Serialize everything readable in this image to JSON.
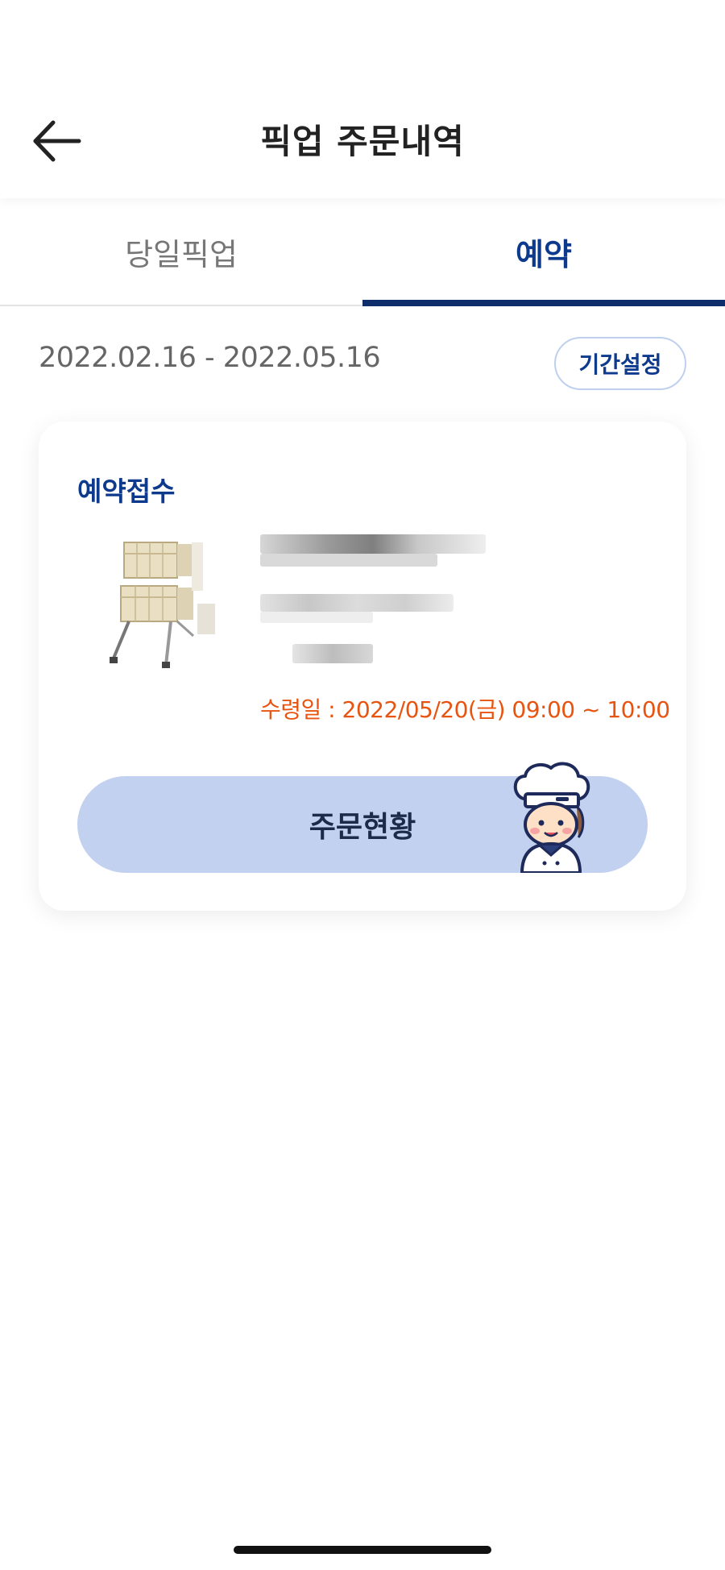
{
  "header": {
    "title": "픽업 주문내역",
    "back_icon": "back-arrow-icon"
  },
  "tabs": [
    {
      "label": "당일픽업",
      "active": false
    },
    {
      "label": "예약",
      "active": true
    }
  ],
  "period": {
    "range": "2022.02.16 - 2022.05.16",
    "button_label": "기간설정"
  },
  "order": {
    "status": "예약접수",
    "pickup_date": "수령일 : 2022/05/20(금) 09:00 ~ 10:00",
    "button_label": "주문현황"
  },
  "colors": {
    "accent": "#0d3a8c",
    "pickup_date": "#e8540f",
    "button_bg": "#c2d1f0"
  }
}
